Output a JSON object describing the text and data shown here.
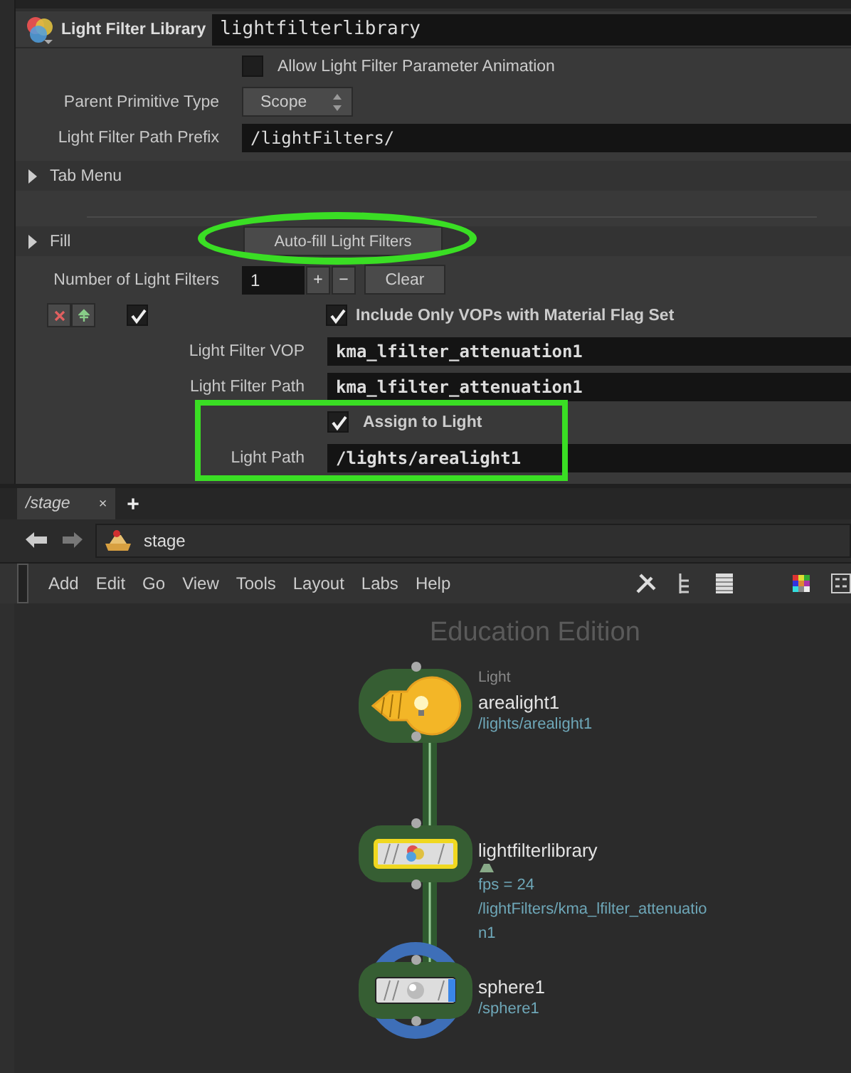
{
  "header": {
    "type": "Light Filter Library",
    "name": "lightfilterlibrary"
  },
  "allow_animation": {
    "label": "Allow Light Filter Parameter Animation",
    "checked": false
  },
  "parent_type": {
    "label": "Parent Primitive Type",
    "value": "Scope"
  },
  "path_prefix": {
    "label": "Light Filter Path Prefix",
    "value": "/lightFilters/"
  },
  "tab_menu": {
    "label": "Tab Menu",
    "expanded": false
  },
  "fill": {
    "label": "Fill",
    "expanded": false,
    "button": "Auto-fill Light Filters"
  },
  "multiparm": {
    "label": "Number of Light Filters",
    "value": "1",
    "plus": "+",
    "minus": "−",
    "clear": "Clear"
  },
  "instance": {
    "enabled": true,
    "include_only": {
      "label": "Include Only VOPs with Material Flag Set",
      "checked": true
    },
    "vop": {
      "label": "Light Filter VOP",
      "value": "kma_lfilter_attenuation1"
    },
    "path": {
      "label": "Light Filter Path",
      "value": "kma_lfilter_attenuation1"
    },
    "assign": {
      "label": "Assign to Light",
      "checked": true
    },
    "light_path": {
      "label": "Light Path",
      "value": "/lights/arealight1"
    }
  },
  "network": {
    "tabs": [
      {
        "label": "/stage",
        "selected": true,
        "close": "×"
      }
    ],
    "add_tab": "+",
    "path": "stage",
    "menu": [
      "Add",
      "Edit",
      "Go",
      "View",
      "Tools",
      "Layout",
      "Labs",
      "Help"
    ],
    "watermark": "Education Edition",
    "nodes": [
      {
        "kind": "light",
        "type": "Light",
        "name": "arealight1",
        "selected": false,
        "display": false,
        "info": [
          "/lights/arealight1"
        ]
      },
      {
        "kind": "filter",
        "name": "lightfilterlibrary",
        "selected": true,
        "display": false,
        "info": [
          "fps = 24",
          "/lightFilters/kma_lfilter_attenuatio",
          "n1"
        ]
      },
      {
        "kind": "sphere",
        "name": "sphere1",
        "selected": false,
        "display": true,
        "info": [
          "/sphere1"
        ]
      }
    ]
  }
}
